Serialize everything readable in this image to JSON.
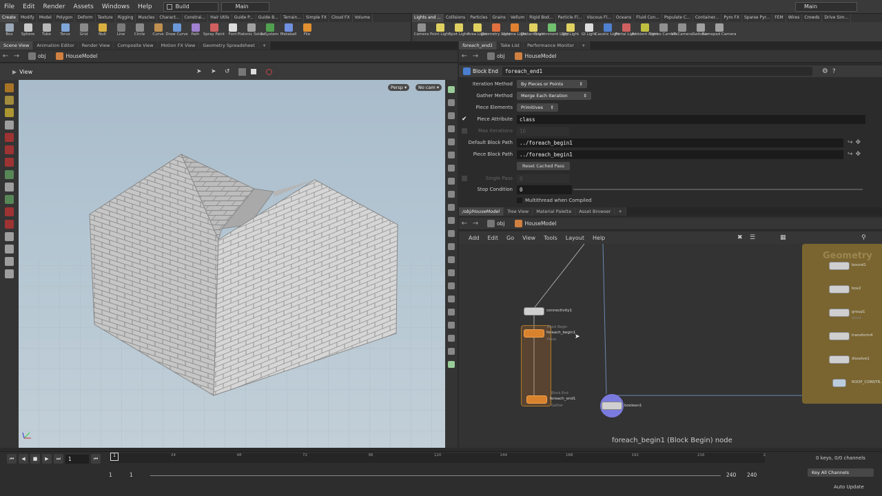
{
  "menubar": {
    "items": [
      "File",
      "Edit",
      "Render",
      "Assets",
      "Windows",
      "Help"
    ],
    "desk": "Build",
    "desk_right": "Main"
  },
  "shelf_left": {
    "tabs": [
      "Create",
      "Modify",
      "Model",
      "Polygon",
      "Deform",
      "Texture",
      "Rigging",
      "Muscles",
      "Charact...",
      "Constrai...",
      "Hair Utils",
      "Guide P...",
      "Guide B...",
      "Terrain...",
      "Simple FX",
      "Cloud FX",
      "Volume"
    ],
    "tools": [
      {
        "label": "Box",
        "color": "#9aa8b8"
      },
      {
        "label": "Sphere",
        "color": "#c8c8c8"
      },
      {
        "label": "Tube",
        "color": "#b8b8b8"
      },
      {
        "label": "Torus",
        "color": "#7fa6d8"
      },
      {
        "label": "Grid",
        "color": "#8a8a8a"
      },
      {
        "label": "Null",
        "color": "#d8b040"
      },
      {
        "label": "Line",
        "color": "#7a7a7a"
      },
      {
        "label": "Circle",
        "color": "#8a8a8a"
      },
      {
        "label": "Curve",
        "color": "#c09050"
      },
      {
        "label": "Draw Curve",
        "color": "#6a98d8"
      },
      {
        "label": "Path",
        "color": "#a080d0"
      },
      {
        "label": "Spray Paint",
        "color": "#d06060"
      },
      {
        "label": "Font",
        "color": "#dddddd"
      },
      {
        "label": "Platonic Solids",
        "color": "#a0a0a0"
      },
      {
        "label": "L-System",
        "color": "#50a050"
      },
      {
        "label": "Metaball",
        "color": "#7090e0"
      },
      {
        "label": "File",
        "color": "#e09030"
      }
    ]
  },
  "shelf_right": {
    "tabs": [
      "Lights and ...",
      "Collisions",
      "Particles",
      "Grains",
      "Vellum",
      "Rigid Bod...",
      "Particle Fl...",
      "Viscous Fl...",
      "Oceans",
      "Fluid Con...",
      "Populate C...",
      "Container...",
      "Pyro FX",
      "Sparse Pyr...",
      "FEM",
      "Wires",
      "Crowds",
      "Drive Sim..."
    ],
    "tools": [
      {
        "label": "Camera",
        "color": "#909090"
      },
      {
        "label": "Point Light",
        "color": "#e0d060"
      },
      {
        "label": "Spot Light",
        "color": "#e0d060"
      },
      {
        "label": "Area Light",
        "color": "#e0d060"
      },
      {
        "label": "Geometry Light",
        "color": "#e07040"
      },
      {
        "label": "Volume Light",
        "color": "#e08030"
      },
      {
        "label": "Distant Light",
        "color": "#e0d060"
      },
      {
        "label": "Environment Light",
        "color": "#70c070"
      },
      {
        "label": "Sky Light",
        "color": "#e0d060"
      },
      {
        "label": "GI Light",
        "color": "#dddddd"
      },
      {
        "label": "Caustic Light",
        "color": "#5080d0"
      },
      {
        "label": "Portal Light",
        "color": "#d06060"
      },
      {
        "label": "Ambient Light",
        "color": "#c0c040"
      },
      {
        "label": "Stereo Camera",
        "color": "#909090"
      },
      {
        "label": "VR Camera",
        "color": "#909090"
      },
      {
        "label": "Switcher",
        "color": "#a0a0a0"
      },
      {
        "label": "Gamepad Camera",
        "color": "#a0a0a0"
      }
    ]
  },
  "left_pane": {
    "tabs": [
      "Scene View",
      "Animation Editor",
      "Render View",
      "Composite View",
      "Motion FX View",
      "Geometry Spreadsheet"
    ],
    "path_root": "obj",
    "path_node": "HouseModel",
    "view_label": "View",
    "persp": "Persp",
    "cam": "No cam"
  },
  "right_top": {
    "tabs": [
      "foreach_end1",
      "Take List",
      "Performance Monitor"
    ],
    "path_root": "obj",
    "path_node": "HouseModel",
    "node_type": "Block End",
    "node_name": "foreach_end1",
    "params": {
      "iteration_method": {
        "label": "Iteration Method",
        "value": "By Pieces or Points"
      },
      "gather_method": {
        "label": "Gather Method",
        "value": "Merge Each Iteration"
      },
      "piece_elements": {
        "label": "Piece Elements",
        "value": "Primitives"
      },
      "piece_attribute": {
        "label": "Piece Attribute",
        "value": "class"
      },
      "max_iterations": {
        "label": "Max Iterations",
        "value": "10"
      },
      "default_block_path": {
        "label": "Default Block Path",
        "value": "../foreach_begin1"
      },
      "piece_block_path": {
        "label": "Piece Block Path",
        "value": "../foreach_begin1"
      },
      "reset_button": "Reset Cached Pass",
      "single_pass": {
        "label": "Single Pass",
        "value": "0"
      },
      "stop_condition": {
        "label": "Stop Condition",
        "value": "0"
      },
      "multithread": "Multithread when Compiled"
    }
  },
  "right_bottom": {
    "tabs": [
      "/obj/HouseModel",
      "Tree View",
      "Material Palette",
      "Asset Browser"
    ],
    "path_root": "obj",
    "path_node": "HouseModel",
    "menu": [
      "Add",
      "Edit",
      "Go",
      "View",
      "Tools",
      "Layout",
      "Help"
    ],
    "nodes": {
      "connectivity": "connectivity1",
      "foreach_begin": "foreach_begin1",
      "foreach_begin_sub": "Piece",
      "foreach_begin_top": "Block Begin",
      "foreach_end": "foreach_end1",
      "foreach_end_sub": "Gather",
      "foreach_end_top": "Block End",
      "boolean": "boolean1"
    },
    "geo_box": {
      "title": "Geometry",
      "nodes": [
        {
          "name": "bound1",
          "sub": ""
        },
        {
          "name": "box2",
          "sub": ""
        },
        {
          "name": "group1",
          "sub": "Grout"
        },
        {
          "name": "transform4",
          "sub": ""
        },
        {
          "name": "dissolve1",
          "sub": ""
        },
        {
          "name": "ROOF_CONSTR...",
          "sub": ""
        }
      ]
    },
    "status": "foreach_begin1 (Block Begin) node"
  },
  "timeline": {
    "frame": "1",
    "ticks": [
      "24",
      "48",
      "72",
      "96",
      "120",
      "144",
      "168",
      "192",
      "216",
      "2"
    ],
    "start": "1",
    "start2": "1",
    "end": "240",
    "end2": "240",
    "keys": "0 keys, 0/0 channels",
    "key_all": "Key All Channels",
    "auto_update": "Auto Update",
    "marker": "1"
  }
}
